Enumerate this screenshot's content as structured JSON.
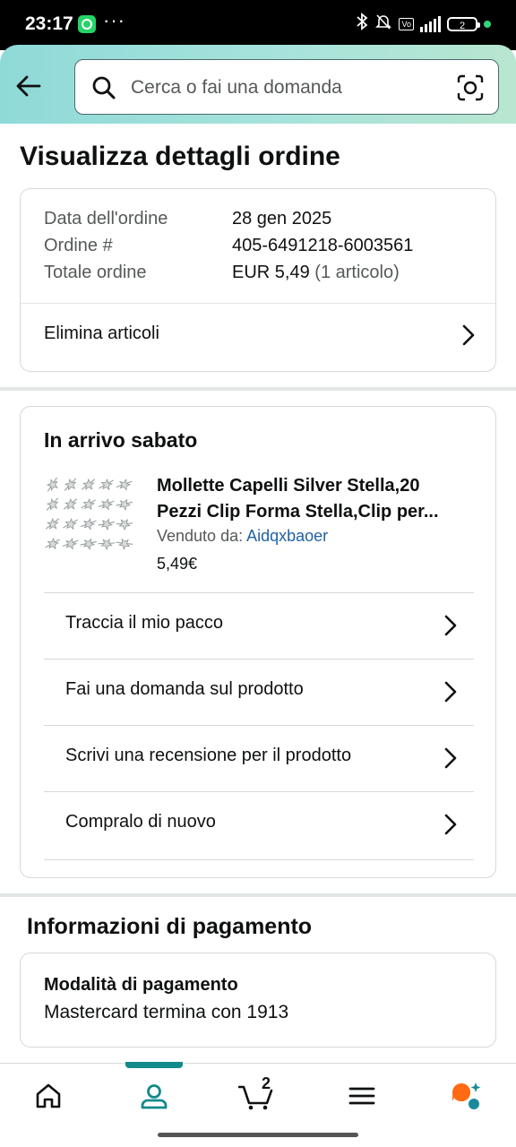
{
  "status_bar": {
    "time": "23:17",
    "dots": "···",
    "battery": "2"
  },
  "search": {
    "placeholder": "Cerca o fai una domanda"
  },
  "page_title": "Visualizza dettagli ordine",
  "order_summary": {
    "rows": [
      {
        "label": "Data dell'ordine",
        "value": "28 gen 2025"
      },
      {
        "label": "Ordine #",
        "value": "405-6491218-6003561"
      },
      {
        "label": "Totale ordine",
        "value": "EUR 5,49",
        "value_extra": "(1 articolo)"
      }
    ],
    "delete_items_label": "Elimina articoli"
  },
  "shipment": {
    "heading": "In arrivo sabato",
    "product": {
      "title_line1": "Mollette Capelli Silver Stella,20",
      "title_line2": "Pezzi Clip Forma Stella,Clip per...",
      "sold_by_label": "Venduto da:",
      "seller": "Aidqxbaoer",
      "price": "5,49€"
    },
    "actions": [
      {
        "label": "Traccia il mio pacco"
      },
      {
        "label": "Fai una domanda sul prodotto"
      },
      {
        "label": "Scrivi una recensione per il prodotto"
      },
      {
        "label": "Compralo di nuovo"
      }
    ]
  },
  "payment": {
    "section_title": "Informazioni di pagamento",
    "method_heading": "Modalità di pagamento",
    "method_value": "Mastercard  termina con 1913"
  },
  "bottom_nav": {
    "items": [
      {
        "icon": "home-icon"
      },
      {
        "icon": "account-icon",
        "active": true
      },
      {
        "icon": "cart-icon",
        "count": "2"
      },
      {
        "icon": "menu-icon"
      },
      {
        "icon": "rufus-assistant-icon"
      }
    ]
  },
  "colors": {
    "accent": "#138a8b",
    "link": "#2162a1",
    "header_from": "#8fd9d8",
    "header_to": "#b8e6d0"
  }
}
